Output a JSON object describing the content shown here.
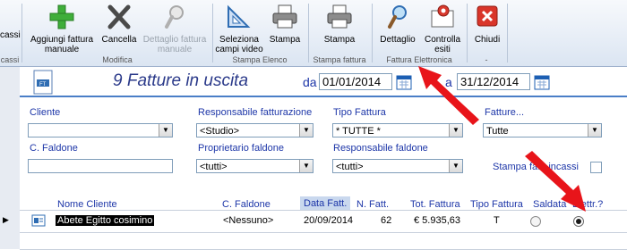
{
  "ribbon": {
    "buttons": {
      "incassi": "cassi",
      "aggiungi": "Aggiungi fattura manuale",
      "cancella": "Cancella",
      "dettaglio_manuale": "Dettaglio fattura manuale",
      "seleziona": "Seleziona campi video",
      "stampa_elenco": "Stampa",
      "stampa_fattura": "Stampa",
      "dettaglio": "Dettaglio",
      "controlla": "Controlla esiti",
      "chiudi": "Chiudi"
    },
    "groups": {
      "incassi": "cassi",
      "modifica": "Modifica",
      "stampa_elenco": "Stampa Elenco",
      "stampa_fattura": "Stampa fattura",
      "fattura_elettronica": "Fattura Elettronica",
      "chiudi": "-"
    }
  },
  "form": {
    "title": "9 Fatture in uscita",
    "da_label": "da",
    "da_value": "01/01/2014",
    "a_label": "a",
    "a_value": "31/12/2014",
    "filters": {
      "cliente_label": "Cliente",
      "cliente_value": "",
      "responsabile_fatt_label": "Responsabile fatturazione",
      "responsabile_fatt_value": "<Studio>",
      "tipo_fattura_label": "Tipo Fattura",
      "tipo_fattura_value": "* TUTTE *",
      "fatture_label": "Fatture...",
      "fatture_value": "Tutte",
      "faldone_label": "C. Faldone",
      "faldone_value": "",
      "proprietario_label": "Proprietario faldone",
      "proprietario_value": "<tutti>",
      "responsabile_fald_label": "Responsabile faldone",
      "responsabile_fald_value": "<tutti>",
      "stampa_incassi_label": "Stampa fatt. incassi"
    },
    "columns": [
      "Nome Cliente",
      "C. Faldone",
      "Data Fatt.",
      "N. Fatt.",
      "Tot. Fattura",
      "Tipo Fattura",
      "Saldata",
      "Elettr.?"
    ],
    "rows": [
      {
        "cliente": "Abete Egitto cosimino",
        "faldone": "<Nessuno>",
        "data": "20/09/2014",
        "numero": "62",
        "totale": "€ 5.935,63",
        "tipo": "T",
        "saldata": false,
        "elettronica": true
      }
    ]
  },
  "colors": {
    "accent": "#1d36a8",
    "title": "#2b3a8a",
    "arrow": "#e8141a",
    "header_sel": "#c9d8ee"
  }
}
